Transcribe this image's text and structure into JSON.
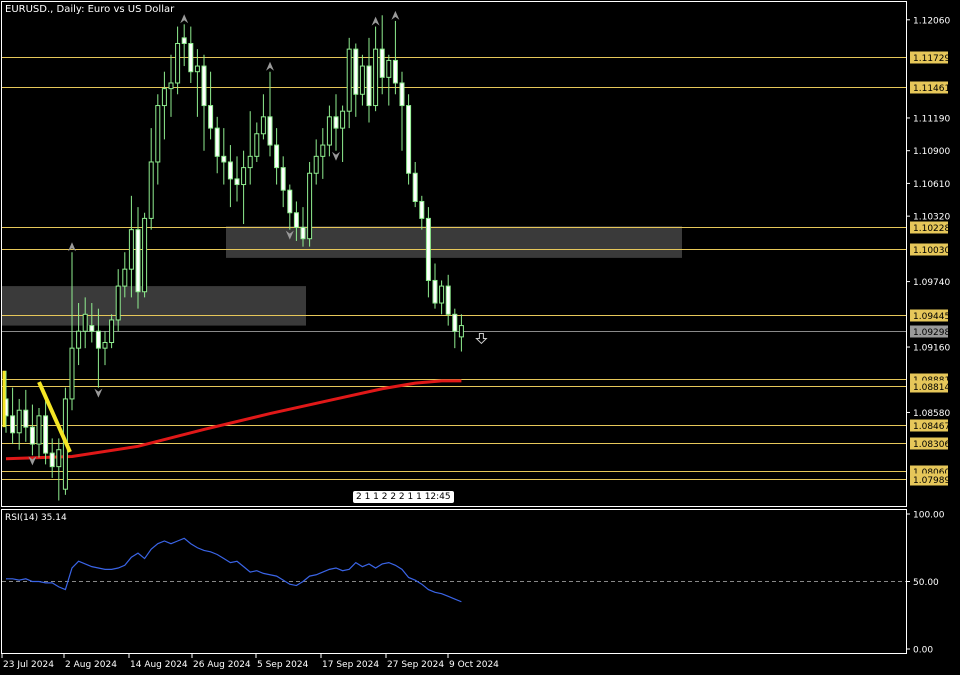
{
  "header": {
    "title": "EURUSD., Daily:  Euro vs US Dollar"
  },
  "rsi": {
    "label": "RSI(14) 35.14"
  },
  "timer": {
    "text": "2 1 1 2 2 2 1 1 12:45"
  },
  "colors": {
    "bull": "#90ee90",
    "bear": "#ffffff",
    "level": "#e6c75a",
    "ma": "#e01818",
    "rsi": "#3a64e6",
    "trend": "#f5e625",
    "zone": "#3a3a3a"
  },
  "chart_data": [
    {
      "type": "candlestick",
      "title": "EURUSD., Daily:  Euro vs US Dollar",
      "ylim": [
        1.0776,
        1.122
      ],
      "price_ticks": [
        "1.12060",
        "1.11190",
        "1.10900",
        "1.10610",
        "1.10320",
        "1.09740",
        "1.09160",
        "1.08580"
      ],
      "levels": [
        "1.11729",
        "1.11461",
        "1.10228",
        "1.10030",
        "1.09445",
        "1.08881",
        "1.08814",
        "1.08467",
        "1.08306",
        "1.08060",
        "1.07989"
      ],
      "level_values": [
        1.11729,
        1.11461,
        1.10228,
        1.1003,
        1.09445,
        1.08881,
        1.08814,
        1.08467,
        1.08306,
        1.0806,
        1.07989
      ],
      "current_price": "1.09298",
      "current_value": 1.09298,
      "x_labels": [
        "23 Jul 2024",
        "2 Aug 2024",
        "14 Aug 2024",
        "26 Aug 2024",
        "5 Sep 2024",
        "17 Sep 2024",
        "27 Sep 2024",
        "9 Oct 2024"
      ],
      "ohlc": [
        [
          1.087,
          1.0895,
          1.084,
          1.0855
        ],
        [
          1.0855,
          1.088,
          1.083,
          1.084
        ],
        [
          1.084,
          1.087,
          1.0825,
          1.086
        ],
        [
          1.086,
          1.0878,
          1.0832,
          1.0845
        ],
        [
          1.0845,
          1.0865,
          1.082,
          1.083
        ],
        [
          1.083,
          1.0862,
          1.0818,
          1.0855
        ],
        [
          1.0855,
          1.0875,
          1.0812,
          1.0822
        ],
        [
          1.0822,
          1.0835,
          1.08,
          1.081
        ],
        [
          1.081,
          1.0835,
          1.078,
          1.0825
        ],
        [
          1.079,
          1.088,
          1.0785,
          1.087
        ],
        [
          1.087,
          1.1,
          1.086,
          1.0915
        ],
        [
          1.0915,
          1.0955,
          1.09,
          1.093
        ],
        [
          1.093,
          1.096,
          1.0915,
          1.0945
        ],
        [
          1.0935,
          1.0955,
          1.092,
          1.093
        ],
        [
          1.093,
          1.095,
          1.088,
          1.0915
        ],
        [
          1.0915,
          1.093,
          1.09,
          1.092
        ],
        [
          1.092,
          1.0945,
          1.0915,
          1.094
        ],
        [
          1.094,
          1.0985,
          1.093,
          1.097
        ],
        [
          1.097,
          1.1,
          1.096,
          1.0985
        ],
        [
          1.0985,
          1.105,
          1.096,
          1.102
        ],
        [
          1.102,
          1.104,
          1.095,
          1.0965
        ],
        [
          1.0965,
          1.1035,
          1.096,
          1.103
        ],
        [
          1.103,
          1.111,
          1.102,
          1.108
        ],
        [
          1.108,
          1.114,
          1.106,
          1.113
        ],
        [
          1.113,
          1.116,
          1.11,
          1.1145
        ],
        [
          1.1145,
          1.1175,
          1.112,
          1.115
        ],
        [
          1.115,
          1.12,
          1.114,
          1.1185
        ],
        [
          1.119,
          1.1202,
          1.1165,
          1.1185
        ],
        [
          1.1185,
          1.12,
          1.115,
          1.116
        ],
        [
          1.116,
          1.118,
          1.112,
          1.1165
        ],
        [
          1.1165,
          1.1175,
          1.109,
          1.113
        ],
        [
          1.113,
          1.116,
          1.11,
          1.111
        ],
        [
          1.111,
          1.112,
          1.107,
          1.1085
        ],
        [
          1.1085,
          1.111,
          1.106,
          1.108
        ],
        [
          1.108,
          1.1095,
          1.104,
          1.1065
        ],
        [
          1.1065,
          1.1085,
          1.1045,
          1.106
        ],
        [
          1.106,
          1.109,
          1.1025,
          1.1075
        ],
        [
          1.1075,
          1.1125,
          1.106,
          1.1085
        ],
        [
          1.1085,
          1.1115,
          1.108,
          1.1105
        ],
        [
          1.1105,
          1.114,
          1.11,
          1.112
        ],
        [
          1.112,
          1.116,
          1.1085,
          1.1095
        ],
        [
          1.1095,
          1.111,
          1.106,
          1.1075
        ],
        [
          1.1075,
          1.1085,
          1.104,
          1.1055
        ],
        [
          1.1055,
          1.106,
          1.102,
          1.1035
        ],
        [
          1.1035,
          1.1045,
          1.101,
          1.1022
        ],
        [
          1.1022,
          1.104,
          1.1005,
          1.1012
        ],
        [
          1.1012,
          1.108,
          1.1005,
          1.107
        ],
        [
          1.107,
          1.11,
          1.106,
          1.1085
        ],
        [
          1.1085,
          1.111,
          1.1065,
          1.1095
        ],
        [
          1.1095,
          1.113,
          1.1085,
          1.112
        ],
        [
          1.112,
          1.114,
          1.109,
          1.111
        ],
        [
          1.111,
          1.113,
          1.108,
          1.1125
        ],
        [
          1.1125,
          1.119,
          1.111,
          1.118
        ],
        [
          1.118,
          1.1185,
          1.112,
          1.114
        ],
        [
          1.114,
          1.1175,
          1.113,
          1.1165
        ],
        [
          1.1165,
          1.119,
          1.1115,
          1.113
        ],
        [
          1.113,
          1.12,
          1.1125,
          1.118
        ],
        [
          1.118,
          1.121,
          1.114,
          1.1155
        ],
        [
          1.1155,
          1.1175,
          1.113,
          1.117
        ],
        [
          1.117,
          1.1205,
          1.114,
          1.115
        ],
        [
          1.115,
          1.116,
          1.109,
          1.113
        ],
        [
          1.113,
          1.114,
          1.106,
          1.107
        ],
        [
          1.107,
          1.108,
          1.104,
          1.1045
        ],
        [
          1.1045,
          1.105,
          1.102,
          1.103
        ],
        [
          1.103,
          1.104,
          1.096,
          1.0975
        ],
        [
          1.0975,
          1.099,
          1.095,
          1.0955
        ],
        [
          1.0955,
          1.0975,
          1.0945,
          1.097
        ],
        [
          1.097,
          1.098,
          1.0935,
          1.0945
        ],
        [
          1.0945,
          1.095,
          1.0915,
          1.093
        ],
        [
          1.0925,
          1.0945,
          1.0912,
          1.0935
        ]
      ],
      "ma": [
        [
          0,
          1.0817
        ],
        [
          10,
          1.0819
        ],
        [
          20,
          1.0828
        ],
        [
          30,
          1.0843
        ],
        [
          40,
          1.0857
        ],
        [
          50,
          1.087
        ],
        [
          57,
          1.0879
        ],
        [
          62,
          1.0884
        ],
        [
          66,
          1.0886
        ],
        [
          69,
          1.0886
        ]
      ],
      "rsi": {
        "ylim": [
          0,
          100
        ],
        "ticks": [
          "100.00",
          "50.00",
          "0.00"
        ],
        "values": [
          52,
          52,
          51,
          52,
          50,
          50,
          49,
          49,
          46,
          44,
          60,
          65,
          63,
          61,
          60,
          59,
          59,
          60,
          62,
          68,
          71,
          67,
          74,
          78,
          80,
          78,
          80,
          82,
          78,
          75,
          73,
          72,
          70,
          67,
          64,
          65,
          61,
          57,
          58,
          56,
          55,
          54,
          51,
          48,
          47,
          50,
          54,
          55,
          57,
          59,
          60,
          58,
          59,
          64,
          61,
          63,
          60,
          63,
          64,
          62,
          59,
          53,
          51,
          48,
          44,
          42,
          41,
          39,
          37,
          35
        ]
      }
    }
  ]
}
